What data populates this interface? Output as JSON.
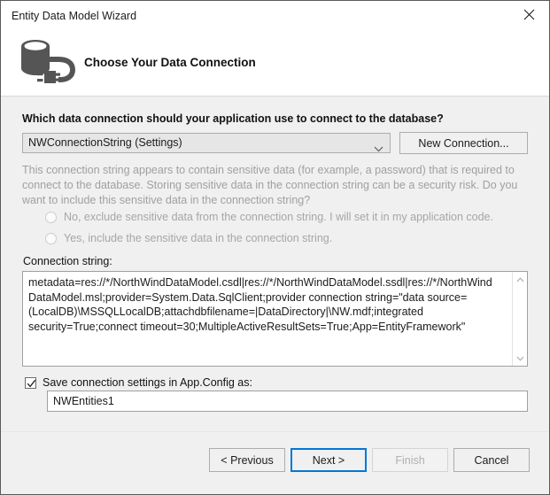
{
  "window": {
    "title": "Entity Data Model Wizard",
    "close_icon": "close-icon"
  },
  "header": {
    "icon": "database-connection-icon",
    "title": "Choose Your Data Connection"
  },
  "main": {
    "question_label": "Which data connection should your application use to connect to the database?",
    "connection_combo": {
      "selected": "NWConnectionString (Settings)",
      "arrow_icon": "chevron-down-icon"
    },
    "new_connection_button": "New Connection...",
    "sensitive_note": "This connection string appears to contain sensitive data (for example, a password) that is required to connect to the database. Storing sensitive data in the connection string can be a security risk. Do you want to include this sensitive data in the connection string?",
    "radio_options": [
      {
        "label": "No, exclude sensitive data from the connection string. I will set it in my application code.",
        "selected": false,
        "disabled": true
      },
      {
        "label": "Yes, include the sensitive data in the connection string.",
        "selected": false,
        "disabled": true
      }
    ],
    "connection_string_label": "Connection string:",
    "connection_string_value": "metadata=res://*/NorthWindDataModel.csdl|res://*/NorthWindDataModel.ssdl|res://*/NorthWindDataModel.msl;provider=System.Data.SqlClient;provider connection string=\"data source=(LocalDB)\\MSSQLLocalDB;attachdbfilename=|DataDirectory|\\NW.mdf;integrated security=True;connect timeout=30;MultipleActiveResultSets=True;App=EntityFramework\"",
    "scroll_up_icon": "chevron-up-icon",
    "scroll_down_icon": "chevron-down-icon",
    "save_checkbox": {
      "label": "Save connection settings in App.Config as:",
      "checked": true,
      "check_icon": "checkmark-icon"
    },
    "entities_name_value": "NWEntities1",
    "entities_name_placeholder": ""
  },
  "footer": {
    "previous_button": "< Previous",
    "next_button": "Next >",
    "finish_button": "Finish",
    "cancel_button": "Cancel"
  },
  "colors": {
    "accent": "#0078d7",
    "body_bg": "#f0f0f0",
    "header_bg": "#ffffff",
    "icon_gray": "#555555",
    "disabled_text": "#a6a6a6"
  }
}
